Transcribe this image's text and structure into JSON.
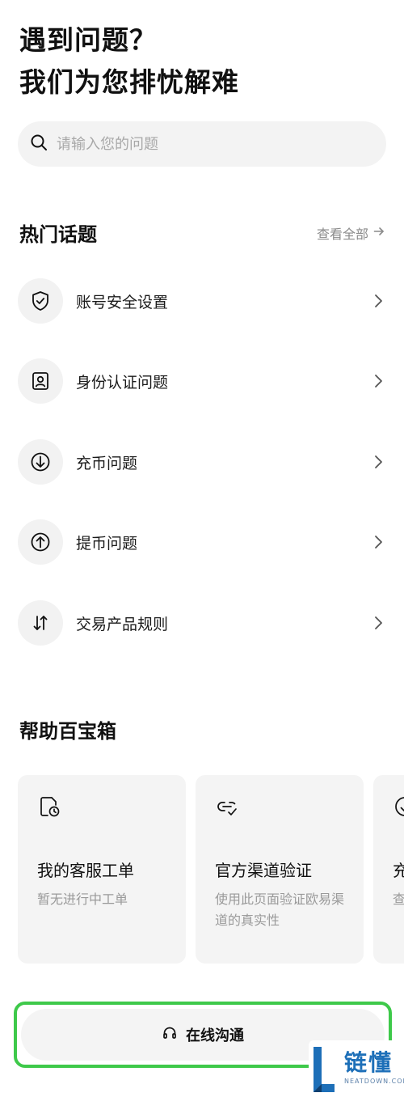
{
  "hero": {
    "line1": "遇到问题？",
    "line2": "我们为您排忧解难"
  },
  "search": {
    "placeholder": "请输入您的问题",
    "value": "",
    "icon": "search-icon"
  },
  "hot_topics": {
    "title": "热门话题",
    "see_all": "查看全部",
    "items": [
      {
        "label": "账号安全设置",
        "icon": "shield-check-icon"
      },
      {
        "label": "身份认证问题",
        "icon": "id-card-icon"
      },
      {
        "label": "充币问题",
        "icon": "deposit-arrow-down-icon"
      },
      {
        "label": "提币问题",
        "icon": "withdraw-arrow-up-icon"
      },
      {
        "label": "交易产品规则",
        "icon": "swap-arrows-icon"
      }
    ]
  },
  "toolbox": {
    "title": "帮助百宝箱",
    "cards": [
      {
        "title": "我的客服工单",
        "desc": "暂无进行中工单",
        "icon": "ticket-clock-icon"
      },
      {
        "title": "官方渠道验证",
        "desc": "使用此页面验证欧易渠道的真实性",
        "icon": "link-check-icon"
      },
      {
        "title": "充",
        "desc": "查",
        "icon": "deposit-arrow-down-icon"
      }
    ]
  },
  "chat": {
    "label": "在线沟通",
    "icon": "headset-icon"
  },
  "watermark": {
    "text": "链懂",
    "sub": "NEATDOWN.COM"
  },
  "colors": {
    "highlight": "#3ec94a",
    "surface": "#f4f4f4",
    "muted_text": "#9a9a9a",
    "watermark_blue": "#1d6fb8"
  }
}
